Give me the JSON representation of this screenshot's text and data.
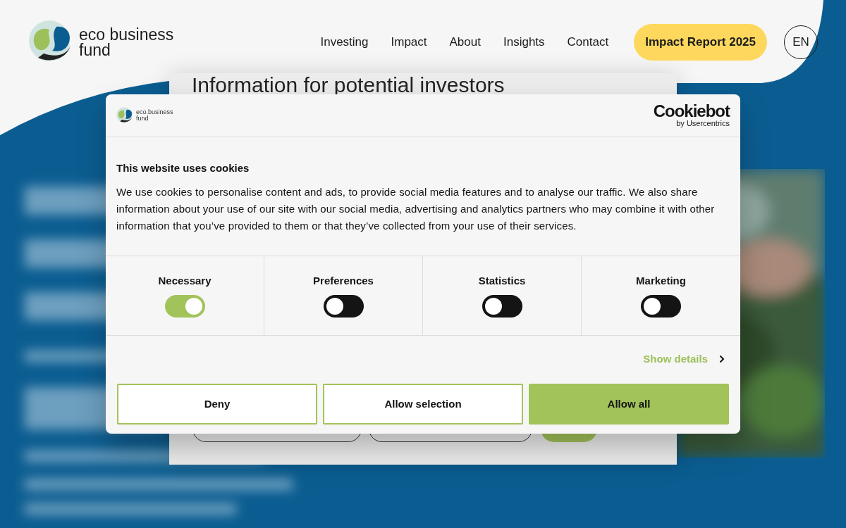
{
  "header": {
    "logo_text": "eco business fund",
    "nav": [
      "Investing",
      "Impact",
      "About",
      "Insights",
      "Contact"
    ],
    "cta": "Impact Report 2025",
    "language": "EN"
  },
  "background_modal": {
    "title": "Information for potential investors"
  },
  "cookie_dialog": {
    "logo_text": "eco.business fund",
    "brand": "Cookiebot",
    "brand_sub": "by Usercentrics",
    "title": "This website uses cookies",
    "text": "We use cookies to personalise content and ads, to provide social media features and to analyse our traffic. We also share information about your use of our site with our social media, advertising and analytics partners who may combine it with other information that you’ve provided to them or that they’ve collected from your use of their services.",
    "categories": [
      {
        "label": "Necessary",
        "checked": true
      },
      {
        "label": "Preferences",
        "checked": false
      },
      {
        "label": "Statistics",
        "checked": false
      },
      {
        "label": "Marketing",
        "checked": false
      }
    ],
    "show_details": "Show details",
    "buttons": [
      {
        "label": "Deny",
        "kind": "outline"
      },
      {
        "label": "Allow selection",
        "kind": "outline"
      },
      {
        "label": "Allow all",
        "kind": "primary"
      }
    ]
  }
}
